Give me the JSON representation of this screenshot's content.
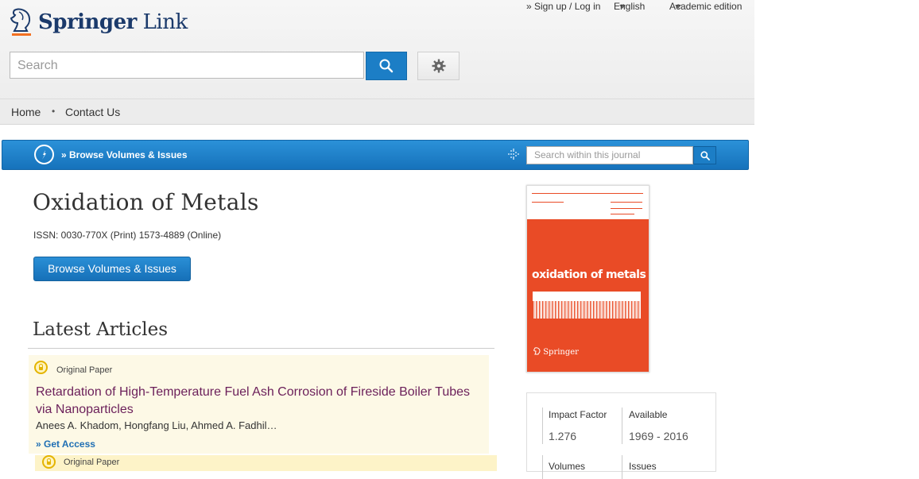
{
  "brand": {
    "name_part1": "Springer",
    "name_part2": "Link"
  },
  "top_links": {
    "signup": "» Sign up / Log in",
    "language": "English",
    "edition": "Academic edition"
  },
  "search": {
    "placeholder": "Search"
  },
  "nav": {
    "home": "Home",
    "contact": "Contact Us"
  },
  "bluebar": {
    "browse_link": "» Browse Volumes & Issues",
    "search_placeholder": "Search within this journal"
  },
  "journal": {
    "title": "Oxidation of Metals",
    "issn": "ISSN: 0030-770X (Print) 1573-4889 (Online)",
    "browse_button": "Browse Volumes & Issues"
  },
  "latest": {
    "heading": "Latest Articles",
    "articles": [
      {
        "type": "Original Paper",
        "title": "Retardation of High-Temperature Fuel Ash Corrosion of Fireside Boiler Tubes via Nanoparticles",
        "authors": "Anees A. Khadom, Hongfang Liu, Ahmed A. Fadhil…",
        "access": "» Get Access"
      },
      {
        "type": "Original Paper"
      }
    ]
  },
  "cover": {
    "title": "oxidation of metals",
    "publisher": "Springer"
  },
  "metrics": {
    "impact_factor_label": "Impact Factor",
    "impact_factor_value": "1.276",
    "available_label": "Available",
    "available_value": "1969 - 2016",
    "volumes_label": "Volumes",
    "issues_label": "Issues"
  },
  "colors": {
    "brand_blue": "#1c7ec6",
    "title_purple": "#6b1f5a",
    "cover_orange": "#e94b26",
    "accent_orange": "#f37021"
  }
}
